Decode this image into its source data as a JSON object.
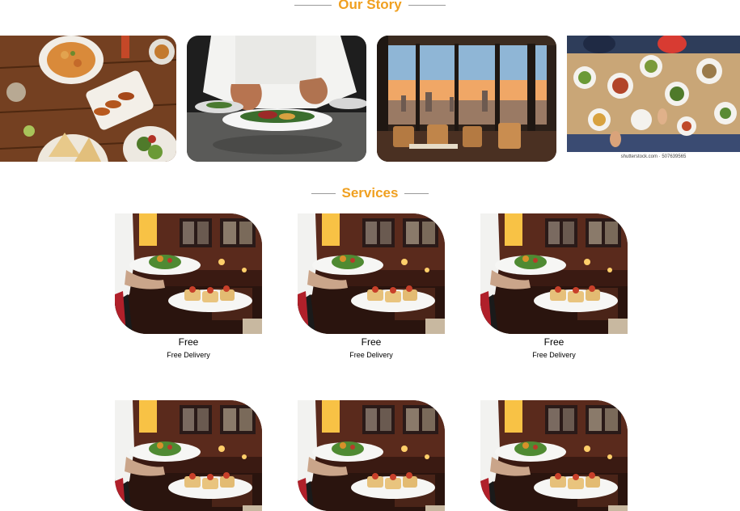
{
  "story": {
    "heading": "Our Story",
    "photos": [
      {
        "name": "food-spread-photo",
        "subject": "overhead table of dishes"
      },
      {
        "name": "chef-plating-photo",
        "subject": "chef garnishing a plate"
      },
      {
        "name": "dining-room-photo",
        "subject": "restaurant interior at sunset"
      },
      {
        "name": "table-topview-photo",
        "subject": "people sharing dishes",
        "credit": "shutterstock.com · 507639565"
      }
    ]
  },
  "services": {
    "heading": "Services",
    "items": [
      {
        "title": "Free",
        "description": "Free Delivery"
      },
      {
        "title": "Free",
        "description": "Free Delivery"
      },
      {
        "title": "Free",
        "description": "Free Delivery"
      },
      {
        "title": "",
        "description": ""
      },
      {
        "title": "",
        "description": ""
      },
      {
        "title": "",
        "description": ""
      }
    ]
  },
  "colors": {
    "accent": "#f0a020",
    "heading_rule": "#9a9a9a",
    "background": "#ffffff"
  }
}
